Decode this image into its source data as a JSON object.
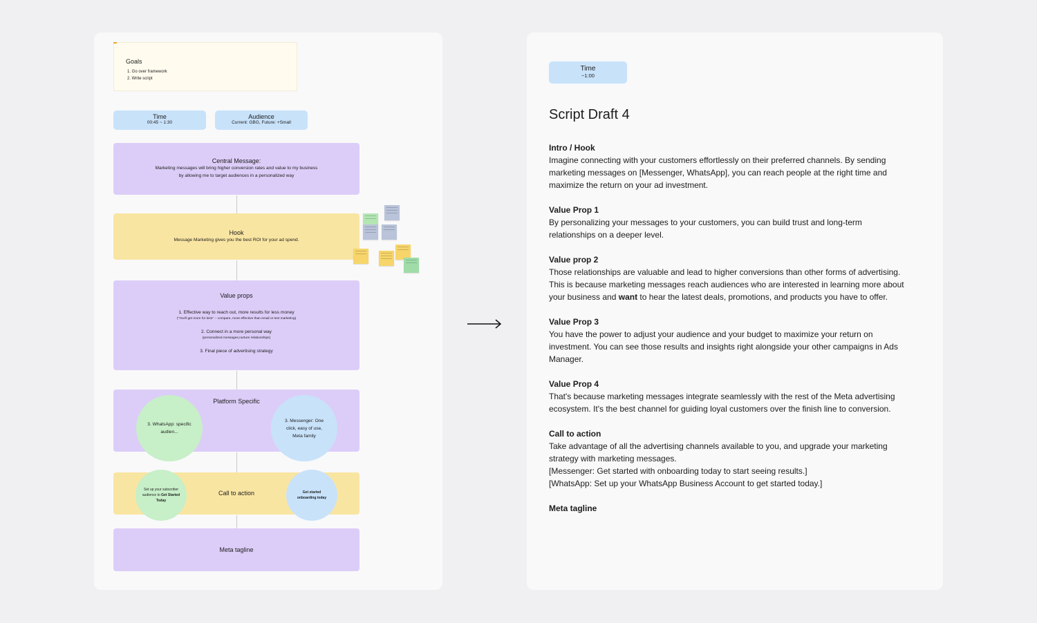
{
  "left": {
    "goals": {
      "title": "Goals",
      "items": [
        "1. Go over framework",
        "2. Write script"
      ]
    },
    "time_chip": {
      "label": "Time",
      "value": "00:45 ~ 1:30"
    },
    "audience_chip": {
      "label": "Audience",
      "value": "Current: GBG, Future: +Small"
    },
    "central": {
      "title": "Central Message:",
      "line1": "Marketing messages will bring higher conversion rates and value to my business",
      "line2": "by allowing me to target audiences in a personalized way"
    },
    "hook": {
      "title": "Hook",
      "text": "Message Marketing gives you the best ROI for your ad spend."
    },
    "value_props": {
      "title": "Value props",
      "p1": "1. Effective way to reach out, more results for less money",
      "p1_note": "(\"You'll get more for less\" -- compare, more effective than email or text marketing)",
      "p2": "2. Connect in a more personal way",
      "p2_note": "(personalized messages,nurture relationships)",
      "p3": "3. Final piece of advertising strategy"
    },
    "platform": {
      "title": "Platform Specific",
      "whatsapp": "3. WhatsApp: specific audien...",
      "messenger": "3. Messenger: One click, easy of use, Meta family"
    },
    "cta": {
      "title": "Call to action",
      "green_pre": "Set up your subscriber audience to ",
      "green_bold": "Get Started Today",
      "blue": "Get started onboarding today"
    },
    "tagline": {
      "title": "Meta tagline"
    },
    "colors": {
      "purple": "#dccdf8",
      "yellow": "#f9e5a2",
      "blue": "#c8e2fa",
      "green": "#c7efc8"
    }
  },
  "right": {
    "time_chip": {
      "label": "Time",
      "value": "~1:00"
    },
    "title": "Script Draft 4",
    "sections": {
      "intro": {
        "heading": "Intro / Hook",
        "text": "Imagine connecting with your customers effortlessly on their preferred channels. By sending marketing messages on [Messenger, WhatsApp], you can reach people at the right time and maximize the return on your ad investment."
      },
      "vp1": {
        "heading": "Value Prop 1",
        "text": "By personalizing your messages to your customers, you can build trust and long-term relationships on a deeper level."
      },
      "vp2": {
        "heading": "Value prop 2",
        "text_pre": "Those relationships are valuable and lead to higher conversions than other forms of advertising. This is because marketing messages reach audiences who are interested in learning more about your business and ",
        "text_bold": "want",
        "text_post": " to hear the latest deals, promotions, and products you have to offer."
      },
      "vp3": {
        "heading": "Value Prop 3",
        "text": "You have the power to adjust your audience and your budget to maximize your return on investment. You can see those results and insights right alongside your other campaigns in Ads Manager."
      },
      "vp4": {
        "heading": "Value Prop 4",
        "text": "That's because marketing messages integrate seamlessly with the rest of the Meta advertising ecosystem. It's the best channel for guiding loyal customers over the finish line to conversion."
      },
      "cta": {
        "heading": "Call to action",
        "line1": "Take advantage of all the advertising channels available to you, and upgrade your marketing strategy with marketing messages.",
        "line2": "[Messenger: Get started with onboarding today to start seeing results.]",
        "line3": "[WhatsApp: Set up your WhatsApp Business Account to get started today.]"
      },
      "tagline": {
        "heading": "Meta tagline"
      }
    }
  }
}
